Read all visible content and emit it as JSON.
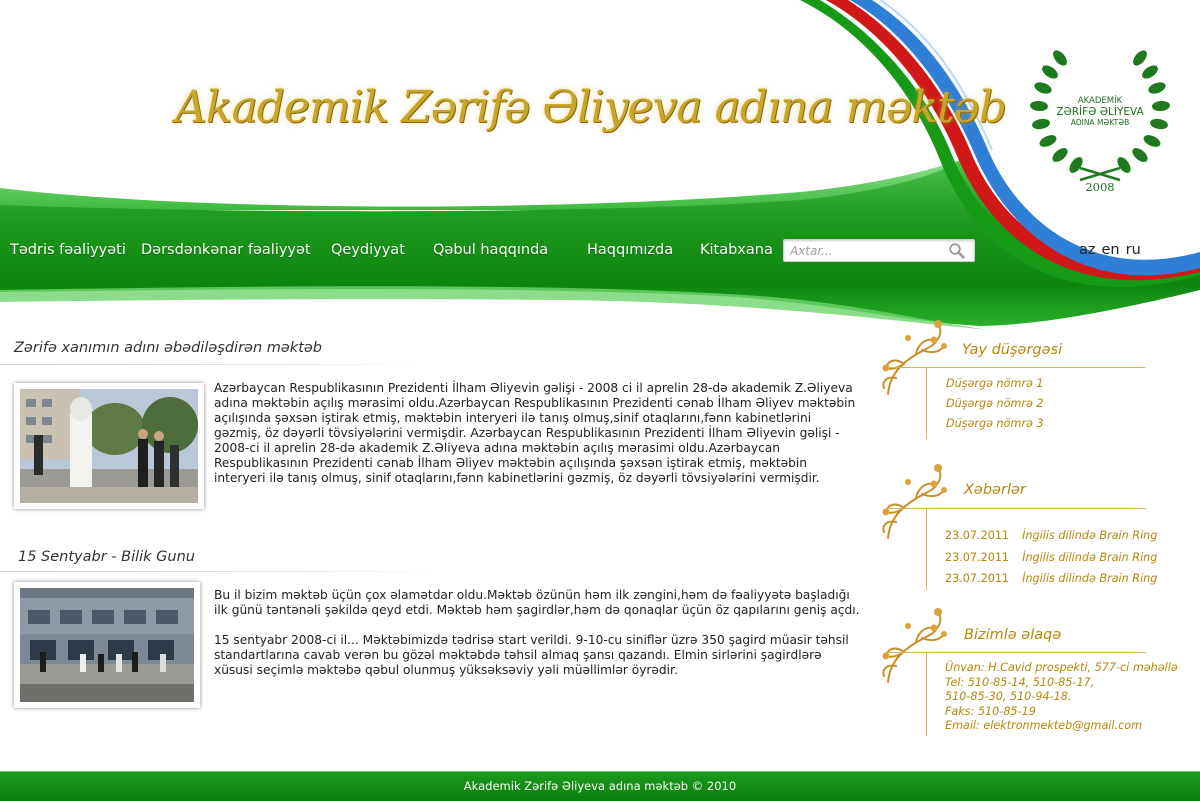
{
  "header": {
    "site_title": "Akademik Zərifə Əliyeva adına məktəb",
    "logo": {
      "line1": "AKADEMİK",
      "line2": "ZƏRİFƏ ƏLİYEVA",
      "line3": "ADINA MƏKTƏB",
      "year": "2008"
    }
  },
  "nav": {
    "items": [
      "Tədris fəaliyyəti",
      "Dərsdənkənar fəaliyyət",
      "Qeydiyyat",
      "Qəbul haqqında",
      "Haqqımızda",
      "Kitabxana"
    ],
    "search_placeholder": "Axtar...",
    "search_icon": "magnifier-icon",
    "languages": [
      "az",
      "en",
      "ru"
    ]
  },
  "articles": [
    {
      "title": "Zərifə xanımın adını əbədiləşdirən məktəb",
      "paragraphs": [
        "Azərbaycan Respublikasının Prezidenti İlham Əliyevin gəlişi - 2008 ci il aprelin 28-də akademik Z.Əliyeva adına məktəbin açılış mərasimi oldu.Azərbaycan Respublikasının Prezidenti cənab İlham Əliyev məktəbin açılışında şəxsən iştirak etmiş, məktəbin interyeri ilə tanış olmuş,sinif otaqlarını,fənn kabinetlərini gəzmiş, öz dəyərli tövsiyələrini vermişdir. Azərbaycan Respublikasının Prezidenti İlham Əliyevin gəlişi - 2008-ci il aprelin 28-də akademik Z.Əliyeva adına məktəbin açılış mərasimi oldu.Azərbaycan Respublikasının Prezidenti cənab İlham Əliyev məktəbin açılışında şəxsən iştirak etmiş, məktəbin interyeri ilə tanış olmuş, sinif otaqlarını,fənn kabinetlərini gəzmiş, öz dəyərli tövsiyələrini vermişdir."
      ]
    },
    {
      "title": "15 Sentyabr - Bilik Gunu",
      "paragraphs": [
        "Bu il bizim məktəb üçün çox əlamətdar oldu.Məktəb özünün həm ilk zəngini,həm də fəaliyyətə başladığı ilk günü təntənəli şəkildə qeyd etdi. Məktəb həm şagirdlər,həm də qonaqlar üçün öz qapılarını geniş açdı.",
        "15 sentyabr 2008-ci il... Məktəbimizdə tədrisə start verildi. 9-10-cu siniflər üzrə 350 şagird müasir təhsil standartlarına cavab verən bu gözəl məktəbdə təhsil almaq şansı qazandı. Elmin sirlərini şagirdlərə xüsusi seçimlə məktəbə qəbul olunmuş yüksəksəviy yəli müəllimlər öyrədir."
      ]
    }
  ],
  "sidebar": {
    "summer_camp": {
      "title": "Yay düşərgəsi",
      "links": [
        "Düşərgə nömrə 1",
        "Düşərgə nömrə 2",
        "Düşərgə nömrə 3"
      ]
    },
    "news": {
      "title": "Xəbərlər",
      "items": [
        {
          "date": "23.07.2011",
          "text": "İngilis dilində Brain Ring"
        },
        {
          "date": "23.07.2011",
          "text": "İngilis dilində Brain Ring"
        },
        {
          "date": "23.07.2011",
          "text": "İngilis dilində Brain Ring"
        }
      ]
    },
    "contact": {
      "title": "Bizimlə əlaqə",
      "lines": [
        "Ünvan: H.Cavid prospekti, 577-ci məhəllə",
        "Tel: 510-85-14, 510-85-17,",
        "510-85-30, 510-94-18.",
        "Faks: 510-85-19",
        "Email: elektronmekteb@gmail.com"
      ]
    }
  },
  "footer": {
    "text": "Akademik Zərifə Əliyeva adına məktəb © 2010"
  },
  "colors": {
    "green": "#1a8f1a",
    "gold": "#b8860b",
    "flag_blue": "#2f7fd6",
    "flag_red": "#d01818",
    "flag_green": "#169a16"
  }
}
